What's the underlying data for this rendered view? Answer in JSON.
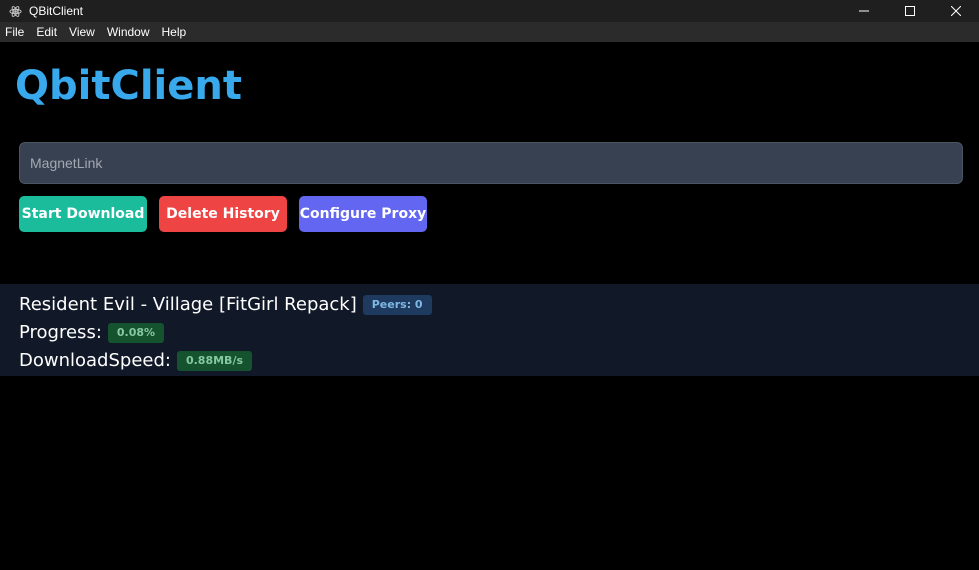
{
  "window": {
    "title": "QBitClient",
    "app_icon": "electron-icon",
    "controls": [
      "minimize-icon",
      "maximize-icon",
      "close-icon"
    ]
  },
  "menu": {
    "items": [
      "File",
      "Edit",
      "View",
      "Window",
      "Help"
    ]
  },
  "app": {
    "logo": "QbitClient",
    "logo_color": "#38a9ec"
  },
  "magnet_input": {
    "placeholder": "MagnetLink",
    "value": ""
  },
  "buttons": {
    "start": "Start Download",
    "delete": "Delete History",
    "proxy": "Configure Proxy"
  },
  "torrent": {
    "name": "Resident Evil - Village [FitGirl Repack]",
    "peers_badge": "Peers: 0",
    "progress_label": "Progress:",
    "progress_value": "0.08%",
    "speed_label": "DownloadSpeed:",
    "speed_value": "0.88MB/s"
  },
  "colors": {
    "start_button": "#1abc9c",
    "delete_button": "#ef4444",
    "proxy_button": "#6366f1",
    "panel_bg": "#111827"
  }
}
